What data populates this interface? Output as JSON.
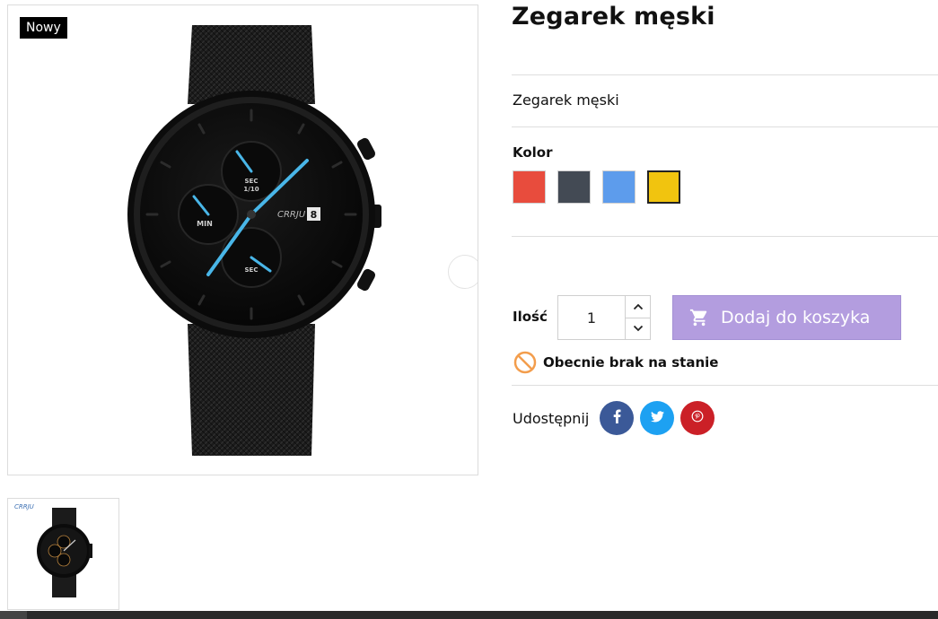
{
  "product": {
    "badge": "Nowy",
    "title": "Zegarek męski",
    "short_description": "Zegarek męski",
    "color_label": "Kolor",
    "colors": [
      {
        "name": "red",
        "hex": "#e84c3d",
        "selected": false
      },
      {
        "name": "dark-gray",
        "hex": "#434a54",
        "selected": false
      },
      {
        "name": "blue",
        "hex": "#5d9cec",
        "selected": false
      },
      {
        "name": "yellow",
        "hex": "#f1c40f",
        "selected": true
      }
    ]
  },
  "watch_dial": {
    "brand": "CRRJU",
    "date": "8",
    "sub_min_label": "MIN",
    "sub_sec_label": "SEC",
    "sub_sec110_label": "SEC\n1/10",
    "accent_color": "#49b6e8"
  },
  "cart": {
    "qty_label": "Ilość",
    "qty_value": "1",
    "add_label": "Dodaj do koszyka",
    "button_color": "#b39ddf",
    "stock_text": "Obecnie brak na stanie"
  },
  "share": {
    "label": "Udostępnij",
    "networks": [
      {
        "name": "facebook",
        "glyph": "f",
        "color": "#3b5998"
      },
      {
        "name": "twitter",
        "glyph": "t",
        "color": "#1da1f2"
      },
      {
        "name": "pinterest",
        "glyph": "p",
        "color": "#cb2027"
      }
    ]
  }
}
